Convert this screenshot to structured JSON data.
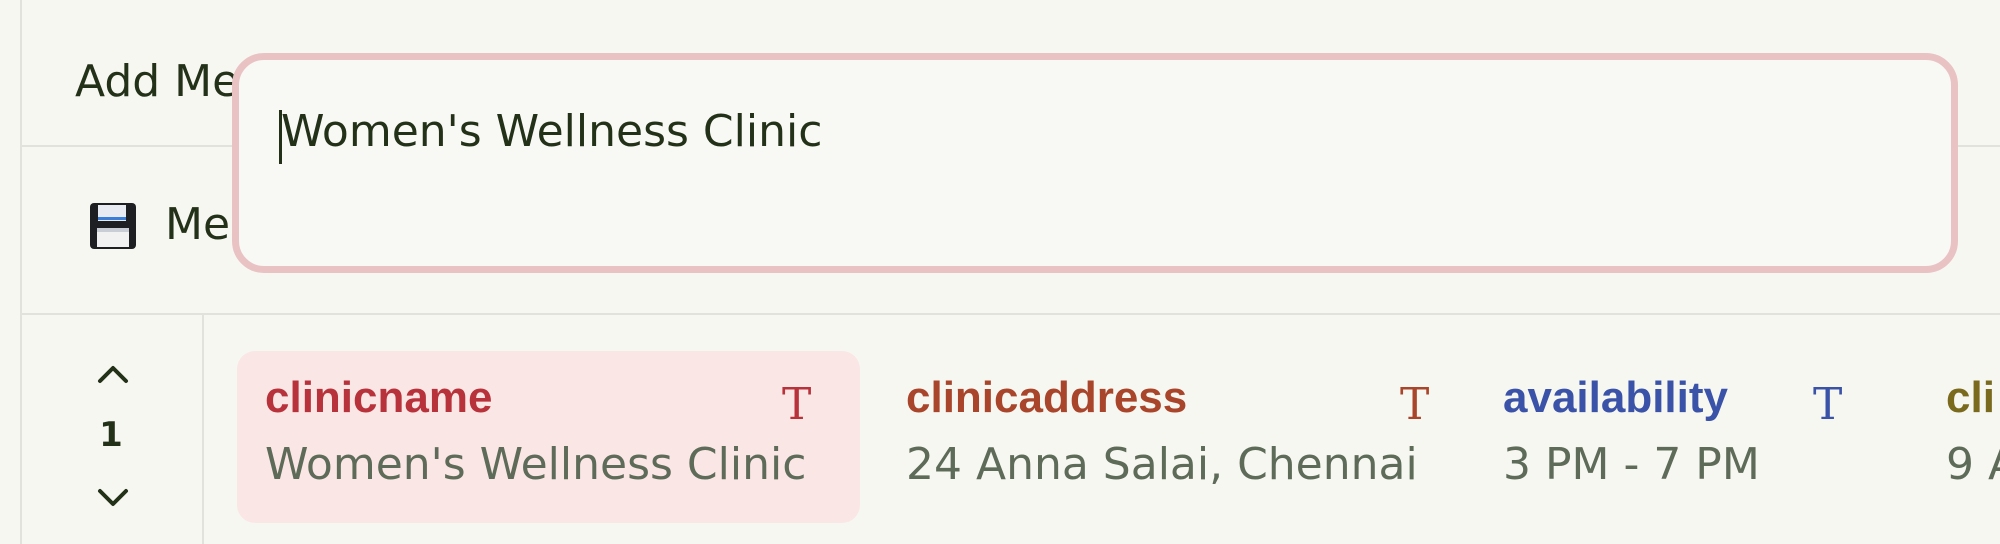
{
  "toolbar": {
    "add_label": "Add Me",
    "save_label": "Me",
    "save_icon": "floppy-disk-icon"
  },
  "editor": {
    "value": "Women's Wellness Clinic",
    "border_color": "#e9c2c3"
  },
  "record_nav": {
    "current": "1",
    "up_icon": "chevron-up-icon",
    "down_icon": "chevron-down-icon"
  },
  "fields": [
    {
      "name": "clinicname",
      "type_icon": "T",
      "value": "Women's Wellness Clinic",
      "color": "#b7323b",
      "selected": true
    },
    {
      "name": "clinicaddress",
      "type_icon": "T",
      "value": "24 Anna Salai, Chennai",
      "color": "#a8452b",
      "selected": false
    },
    {
      "name": "availability",
      "type_icon": "T",
      "value": "3 PM - 7 PM",
      "color": "#3a53a8",
      "selected": false
    },
    {
      "name": "cli",
      "type_icon": "",
      "value": "9 A",
      "color": "#7a6a1e",
      "selected": false
    }
  ]
}
